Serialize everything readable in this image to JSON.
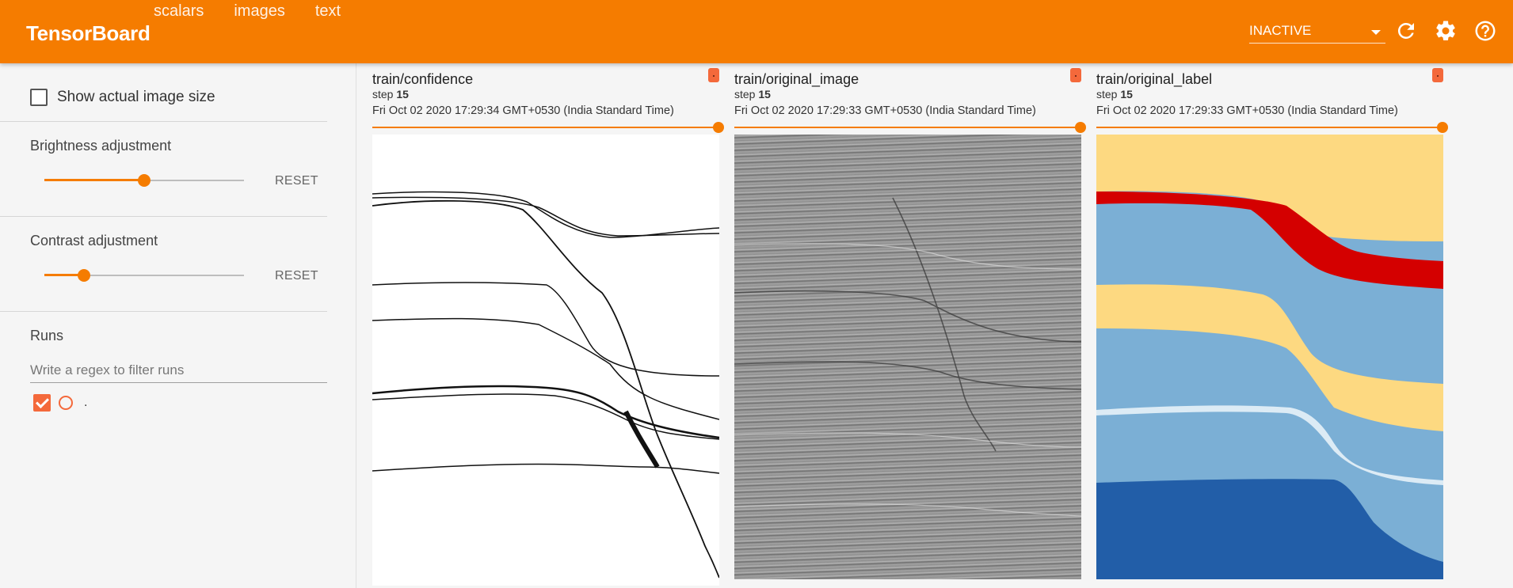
{
  "app": {
    "title": "TensorBoard",
    "accent_color": "#f57c00",
    "tabs": [
      "scalars",
      "images",
      "text"
    ],
    "selector_value": "INACTIVE",
    "icons": [
      "refresh-icon",
      "settings-icon",
      "help-icon"
    ]
  },
  "sidebar": {
    "show_actual_label": "Show actual image size",
    "brightness": {
      "title": "Brightness adjustment",
      "value": 0.5,
      "reset": "RESET"
    },
    "contrast": {
      "title": "Contrast adjustment",
      "value": 0.2,
      "reset": "RESET"
    },
    "runs": {
      "title": "Runs",
      "filter_placeholder": "Write a regex to filter runs",
      "items": [
        {
          "name": ".",
          "checked": true
        }
      ]
    }
  },
  "cards": [
    {
      "title": "train/confidence",
      "step_label": "step",
      "step": "15",
      "timestamp": "Fri Oct 02 2020 17:29:34 GMT+0530 (India Standard Time)"
    },
    {
      "title": "train/original_image",
      "step_label": "step",
      "step": "15",
      "timestamp": "Fri Oct 02 2020 17:29:33 GMT+0530 (India Standard Time)"
    },
    {
      "title": "train/original_label",
      "step_label": "step",
      "step": "15",
      "timestamp": "Fri Oct 02 2020 17:29:33 GMT+0530 (India Standard Time)"
    }
  ],
  "label_colors": {
    "yellow": "#fdd981",
    "light_blue": "#7bafd5",
    "red": "#d40000",
    "dark_blue": "#225ea8",
    "pale": "#dcebf5"
  }
}
